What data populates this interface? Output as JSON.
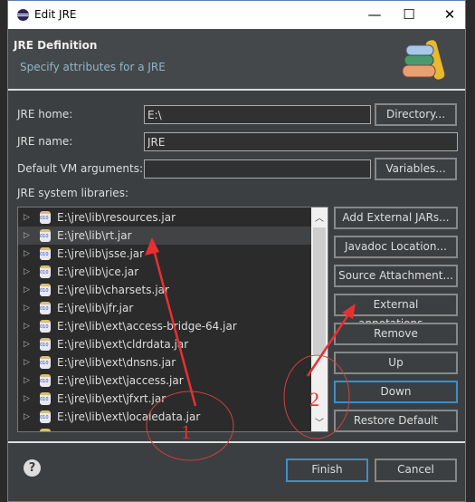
{
  "window": {
    "title": "Edit JRE",
    "minimize": "—",
    "maximize": "☐",
    "close": "✕"
  },
  "header": {
    "title": "JRE Definition",
    "subtitle": "Specify attributes for a JRE"
  },
  "form": {
    "jre_home_label": "JRE home:",
    "jre_home_value": "E:\\",
    "directory_button": "Directory...",
    "jre_name_label": "JRE name:",
    "jre_name_value": "JRE",
    "vm_args_label": "Default VM arguments:",
    "vm_args_value": "",
    "variables_button": "Variables...",
    "libraries_label": "JRE system libraries:"
  },
  "libraries": [
    "E:\\jre\\lib\\resources.jar",
    "E:\\jre\\lib\\rt.jar",
    "E:\\jre\\lib\\jsse.jar",
    "E:\\jre\\lib\\jce.jar",
    "E:\\jre\\lib\\charsets.jar",
    "E:\\jre\\lib\\jfr.jar",
    "E:\\jre\\lib\\ext\\access-bridge-64.jar",
    "E:\\jre\\lib\\ext\\cldrdata.jar",
    "E:\\jre\\lib\\ext\\dnsns.jar",
    "E:\\jre\\lib\\ext\\jaccess.jar",
    "E:\\jre\\lib\\ext\\jfxrt.jar",
    "E:\\jre\\lib\\ext\\localedata.jar"
  ],
  "selected_library": "E:\\jre\\lib\\rt.jar",
  "side_buttons": [
    "Add External JARs...",
    "Javadoc Location...",
    "Source Attachment...",
    "External annotations...",
    "Remove",
    "Up",
    "Down",
    "Restore Default"
  ],
  "footer": {
    "help": "?",
    "finish": "Finish",
    "cancel": "Cancel"
  },
  "annotations": {
    "label1": "1",
    "label2": "2",
    "color": "#e83030"
  }
}
